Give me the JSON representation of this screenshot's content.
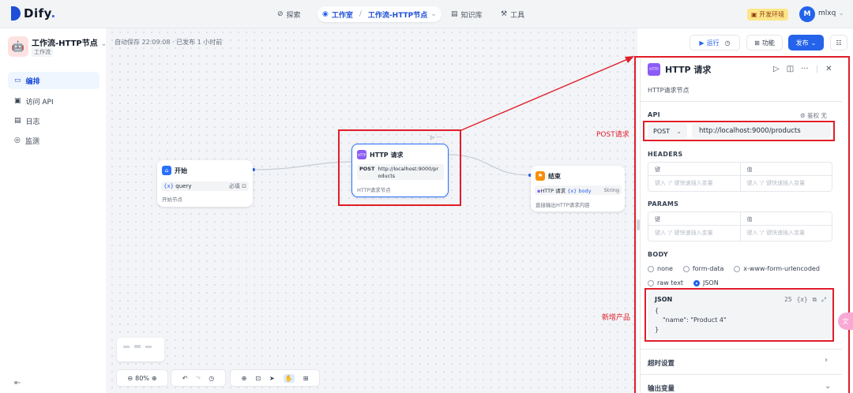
{
  "brand": {
    "name": "Dify",
    "suffix": "."
  },
  "nav": {
    "explore": "探索",
    "studio": "工作室",
    "separator": "/",
    "current_app": "工作流-HTTP节点",
    "knowledge": "知识库",
    "tools": "工具"
  },
  "env_badge": "开发环境",
  "user": {
    "initial": "M",
    "name": "mlxq"
  },
  "app": {
    "title": "工作流-HTTP节点",
    "tag": "工作流"
  },
  "sidebar": {
    "items": [
      {
        "label": "编排",
        "icon": "layout-icon"
      },
      {
        "label": "访问 API",
        "icon": "terminal-icon"
      },
      {
        "label": "日志",
        "icon": "document-icon"
      },
      {
        "label": "监测",
        "icon": "monitor-icon"
      }
    ]
  },
  "status": "自动保存 22:09:08 · 已发布 1 小时前",
  "toolbar": {
    "run": "运行",
    "features": "功能",
    "publish": "发布"
  },
  "nodes": {
    "start": {
      "title": "开始",
      "var": "query",
      "required": "必填",
      "desc": "开始节点",
      "var_prefix": "{x}"
    },
    "http": {
      "title": "HTTP 请求",
      "method": "POST",
      "url": "http://localhost:9000/products",
      "desc": "HTTP请求节点"
    },
    "end": {
      "title": "结束",
      "out_src": "HTTP 请求",
      "out_var": "body",
      "out_type": "String",
      "desc": "直接输出HTTP请求内容",
      "var_prefix": "{x}"
    }
  },
  "zoom": {
    "level": "80%"
  },
  "panel": {
    "title": "HTTP 请求",
    "subtitle": "HTTP请求节点",
    "api_label": "API",
    "auth": "鉴权 无",
    "method": "POST",
    "url": "http://localhost:9000/products",
    "headers_label": "HEADERS",
    "params_label": "PARAMS",
    "key_col": "键",
    "value_col": "值",
    "key_placeholder": "键入 '/' 键快速插入变量",
    "value_placeholder": "键入 '/' 键快速插入变量",
    "body_label": "BODY",
    "body_types": [
      "none",
      "form-data",
      "x-www-form-urlencoded",
      "raw text",
      "JSON"
    ],
    "body_selected": "JSON",
    "json_label": "JSON",
    "json_count": "25",
    "json_var": "{x}",
    "json_lines": [
      "{",
      "\"name\": \"Product 4\"",
      "}"
    ],
    "timeout": "超时设置",
    "output_vars": "输出变量"
  },
  "annotations": {
    "post": "POST请求",
    "new_product": "新增产品"
  },
  "colors": {
    "accent": "#2563eb",
    "annotation_red": "#e11d2a",
    "http_icon": "#8b5cf6",
    "end_icon": "#f79009",
    "start_icon": "#2970ff"
  }
}
